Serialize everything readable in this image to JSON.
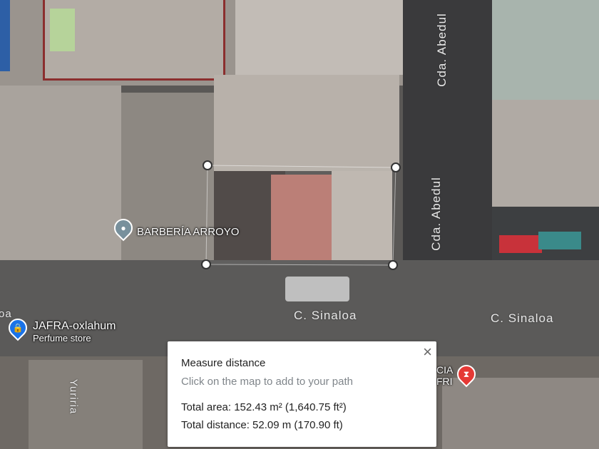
{
  "places": [
    {
      "name": "BARBERÍA ARROYO",
      "icon": "place-pin-icon",
      "color": "#78909c"
    },
    {
      "name": "JAFRA-oxlahum",
      "subtitle": "Perfume store",
      "icon": "shopping-bag-icon",
      "color": "#1a73e8"
    },
    {
      "name_fragment_1": "CIA",
      "name_fragment_2": "FRI",
      "icon": "pharmacy-icon",
      "color": "#e53935"
    }
  ],
  "streets": {
    "sinaloa_left": "C. Sinaloa",
    "sinaloa_right": "C. Sinaloa",
    "abedul_top": "Cda. Abedul",
    "abedul_mid": "Cda. Abedul",
    "yuriria": "Yuriria",
    "partial_left": "oa"
  },
  "measure": {
    "title": "Measure distance",
    "hint": "Click on the map to add to your path",
    "total_area": "Total area: 152.43 m² (1,640.75 ft²)",
    "total_distance": "Total distance: 52.09 m (170.90 ft)",
    "close_icon": "×"
  }
}
